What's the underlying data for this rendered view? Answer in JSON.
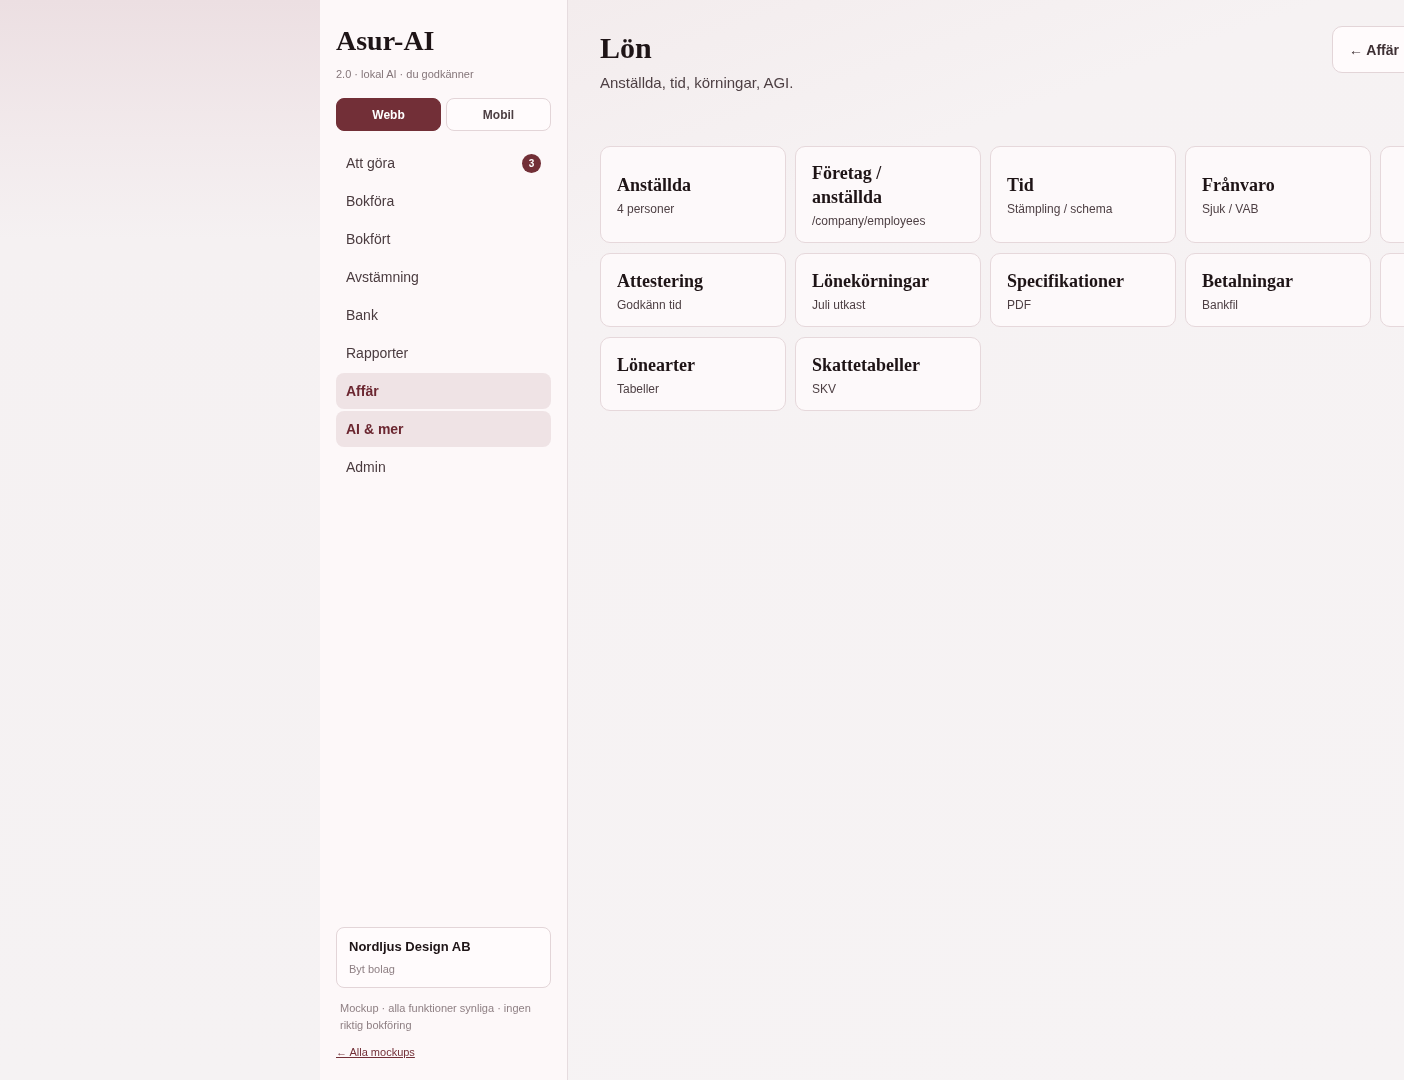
{
  "brand": {
    "name": "Asur-AI",
    "tagline": "2.0 · lokal AI · du godkänner"
  },
  "view_toggle": [
    {
      "label": "Webb",
      "selected": true
    },
    {
      "label": "Mobil",
      "selected": false
    }
  ],
  "nav": [
    {
      "label": "Att göra",
      "selected": false,
      "badge": "3"
    },
    {
      "label": "Bokföra",
      "selected": false
    },
    {
      "label": "Bokfört",
      "selected": false
    },
    {
      "label": "Avstämning",
      "selected": false
    },
    {
      "label": "Bank",
      "selected": false
    },
    {
      "label": "Rapporter",
      "selected": false
    },
    {
      "label": "Affär",
      "selected": true
    },
    {
      "label": "AI & mer",
      "selected": true
    },
    {
      "label": "Admin",
      "selected": false
    }
  ],
  "company": {
    "name": "Nordljus Design AB",
    "action": "Byt bolag"
  },
  "note": "Mockup · alla funktioner synliga · ingen riktig bokföring",
  "back_link": "← Alla mockups",
  "page": {
    "title": "Lön",
    "subtitle": "Anställda, tid, körningar, AGI.",
    "back_button": "← Affär"
  },
  "cards": [
    {
      "kind": "full",
      "title": "Anställda",
      "subtitle": "4 personer"
    },
    {
      "kind": "full",
      "title": "Företag / anställda",
      "subtitle": "/company/employees"
    },
    {
      "kind": "full",
      "title": "Tid",
      "subtitle": "Stämpling / schema"
    },
    {
      "kind": "full",
      "title": "Frånvaro",
      "subtitle": "Sjuk / VAB"
    },
    {
      "kind": "clipped"
    },
    {
      "kind": "full",
      "title": "Attestering",
      "subtitle": "Godkänn tid"
    },
    {
      "kind": "full",
      "title": "Lönekörningar",
      "subtitle": "Juli utkast"
    },
    {
      "kind": "full",
      "title": "Specifikationer",
      "subtitle": "PDF"
    },
    {
      "kind": "full",
      "title": "Betalningar",
      "subtitle": "Bankfil"
    },
    {
      "kind": "clipped"
    },
    {
      "kind": "full",
      "title": "Lönearter",
      "subtitle": "Tabeller"
    },
    {
      "kind": "full",
      "title": "Skattetabeller",
      "subtitle": "SKV"
    }
  ]
}
